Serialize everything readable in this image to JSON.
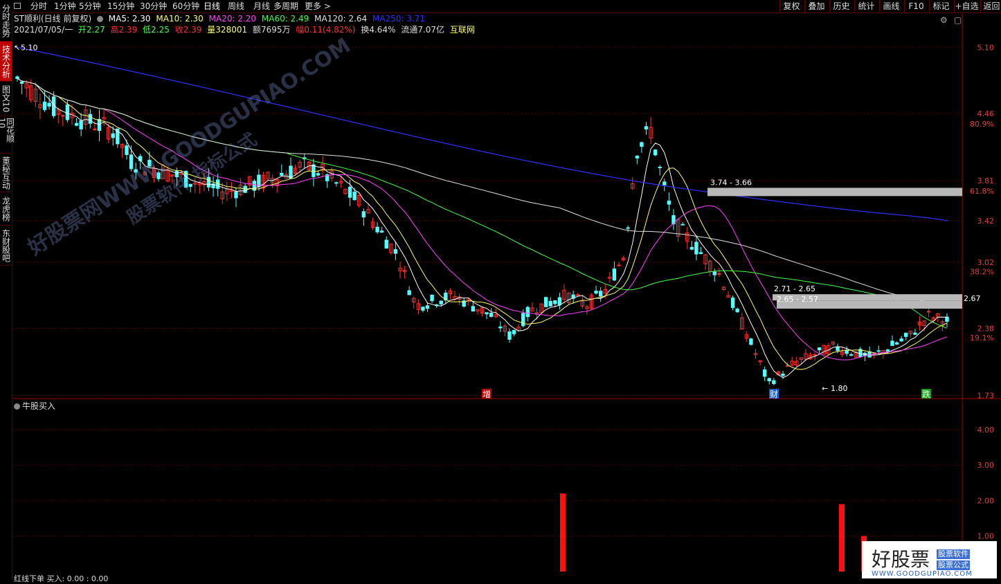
{
  "sidebar": {
    "items": [
      {
        "label": "分时走势",
        "active": false
      },
      {
        "label": "技术分析",
        "active": true
      },
      {
        "label": "图文10",
        "active": false
      },
      {
        "label": "同花顺10",
        "active": false
      },
      {
        "label": "董秘互动",
        "active": false
      },
      {
        "label": "龙虎榜",
        "active": false
      },
      {
        "label": "东财股吧",
        "active": false
      }
    ]
  },
  "toolbar": {
    "periods": [
      "分时",
      "1分钟",
      "5分钟",
      "15分钟",
      "30分钟",
      "60分钟",
      "日线",
      "周线",
      "月线",
      "多周期",
      "更多 >"
    ],
    "active_period": "日线",
    "right_buttons": [
      "复权",
      "叠加",
      "历史",
      "统计",
      "画线",
      "F10",
      "标记",
      "+自选",
      "返回"
    ]
  },
  "info": {
    "stock_name": "ST顺利(日线 前复权)",
    "ma5": "MA5: 2.30",
    "ma10": "MA10: 2.30",
    "ma20": "MA20: 2.20",
    "ma60": "MA60: 2.49",
    "ma120": "MA120: 2.64",
    "ma250": "MA250: 3.71",
    "date": "2021/07/05/一",
    "open": "开2.27",
    "high": "高2.39",
    "low": "低2.25",
    "close": "收2.39",
    "volume": "量328001",
    "amount": "额7695万",
    "change": "幅0.11(4.82%)",
    "turnover": "换4.64%",
    "float_cap": "流通7.07亿",
    "sector": "互联网"
  },
  "colors": {
    "up": "#ff3030",
    "down": "#54ffff",
    "ma5": "#ffffff",
    "ma10": "#ffff60",
    "ma20": "#ff40ff",
    "ma60": "#40ff40",
    "ma120": "#e0e0e0",
    "ma250": "#3030ff"
  },
  "price_axis": {
    "ticks": [
      "5.10",
      "4.46",
      "80.9%",
      "3.81",
      "61.8%",
      "3.42",
      "3.02",
      "38.2%",
      "2.67",
      "2.38",
      "19.1%",
      "1.73"
    ]
  },
  "annotations": {
    "high_label": "5.10",
    "low_label": "1.80",
    "gap1": "3.74 - 3.66",
    "gap2a": "2.71 - 2.65",
    "gap2b": "2.65 - 2.57",
    "event_zeng": "增",
    "event_cai": "财",
    "event_die": "跌"
  },
  "sub_chart": {
    "title": "牛股买入",
    "ticks": [
      "4.00",
      "3.00",
      "2.00",
      "1.00"
    ],
    "bars": [
      {
        "index": 0,
        "value": 2.2
      },
      {
        "index": 1,
        "value": 1.9
      },
      {
        "index": 2,
        "value": 1.0
      }
    ]
  },
  "watermarks": {
    "line1": "好股票网WWW.GOODGUPIAO.COM",
    "line2": "股票软件 指标公式"
  },
  "logo": {
    "name": "好股票",
    "tag1": "股票软件",
    "tag2": "股票公式",
    "url": "WWW.GOODGUPIAO.COM"
  },
  "bottom_text": "红线下单  买入: 0.00  : 0.00"
}
